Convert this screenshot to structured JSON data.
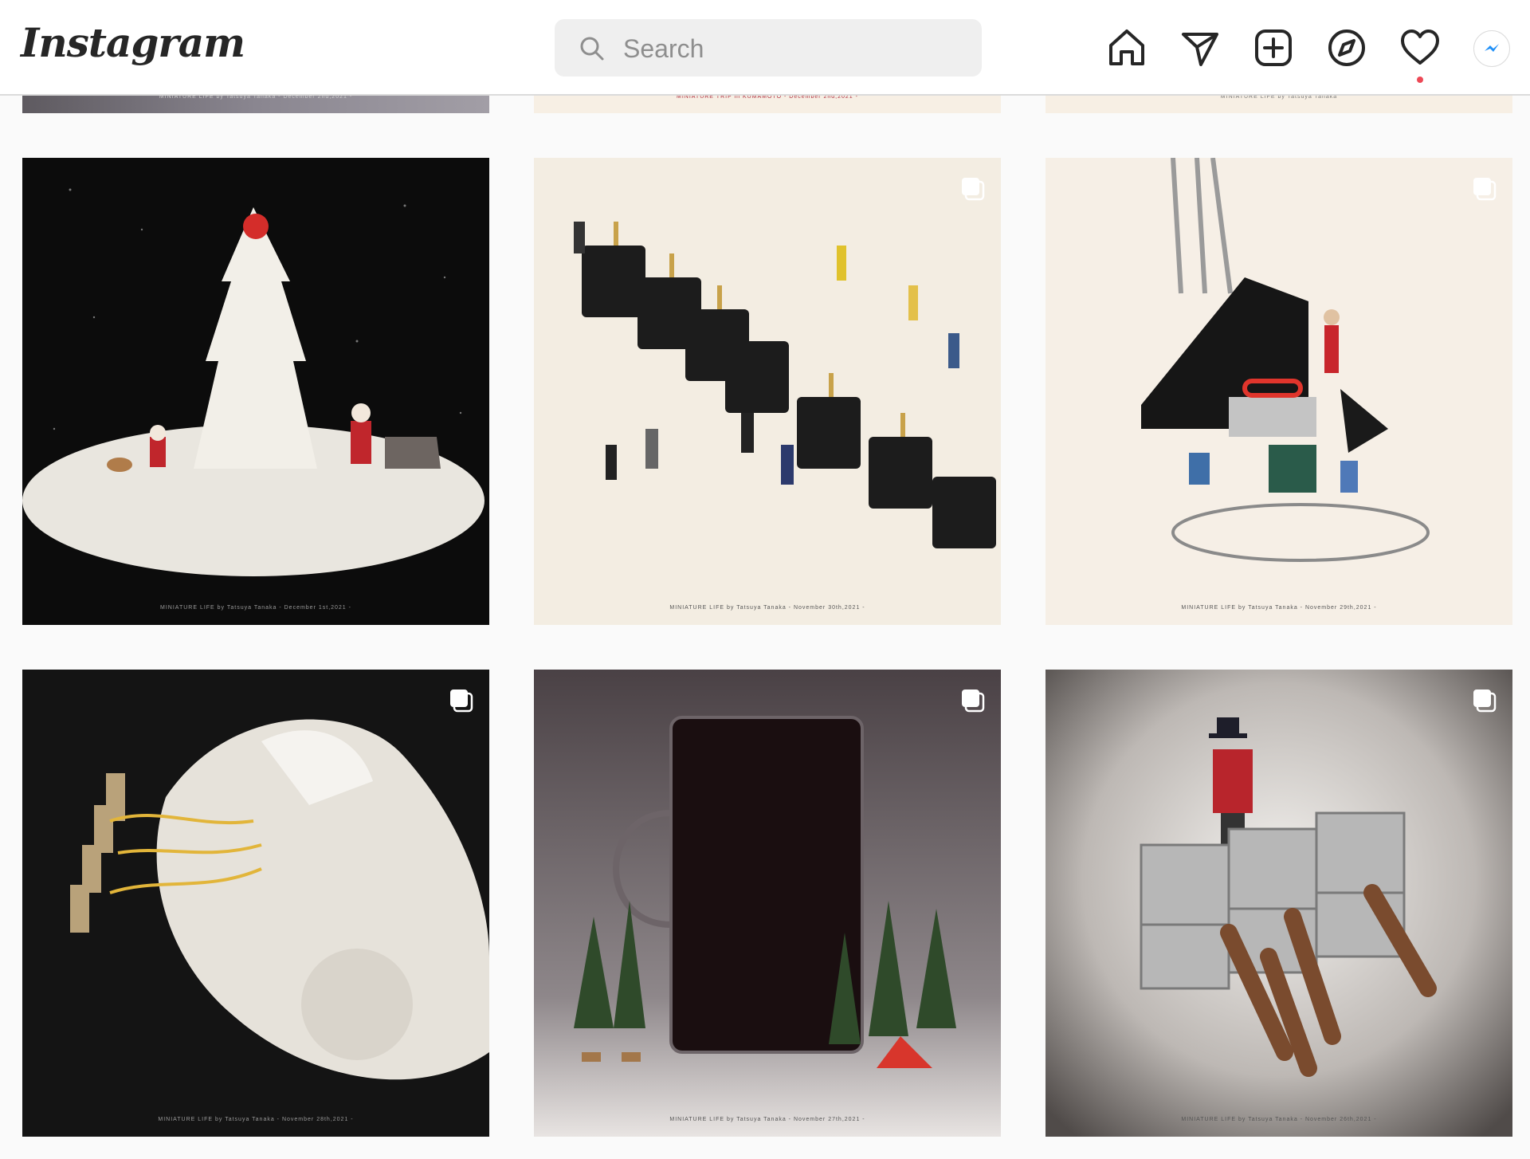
{
  "header": {
    "logo": "Instagram",
    "search_placeholder": "Search",
    "icons": [
      "home-icon",
      "direct-message-icon",
      "new-post-icon",
      "explore-icon",
      "activity-heart-icon",
      "messenger-icon"
    ],
    "notification_dot_color": "#ed4956"
  },
  "grid": {
    "top_row_captions": [
      "MINIATURE LIFE by Tatsuya Tanaka - December 2nd,2021 -",
      "MINIATURE TRIP in KUMAMOTO - December 2nd,2021 -",
      "MINIATURE LIFE by Tatsuya Tanaka"
    ],
    "posts": [
      {
        "caption": "MINIATURE LIFE by Tatsuya Tanaka - December 1st,2021 -",
        "multi": false,
        "bg": "#0c0c0c",
        "caption_color": "#9a9a9a"
      },
      {
        "caption": "MINIATURE LIFE by Tatsuya Tanaka - November 30th,2021 -",
        "multi": true,
        "bg": "#f3ede2",
        "caption_color": "#555555"
      },
      {
        "caption": "MINIATURE LIFE by Tatsuya Tanaka - November 29th,2021 -",
        "multi": true,
        "bg": "#f6efe6",
        "caption_color": "#555555"
      },
      {
        "caption": "MINIATURE LIFE by Tatsuya Tanaka - November 28th,2021 -",
        "multi": true,
        "bg": "#141414",
        "caption_color": "#9a9a9a"
      },
      {
        "caption": "MINIATURE LIFE by Tatsuya Tanaka - November 27th,2021 -",
        "multi": true,
        "bg": "#3b3437",
        "caption_color": "#555555"
      },
      {
        "caption": "MINIATURE LIFE by Tatsuya Tanaka - November 26th,2021 -",
        "multi": true,
        "bg": "#6e6a68",
        "caption_color": "#555555"
      }
    ]
  }
}
